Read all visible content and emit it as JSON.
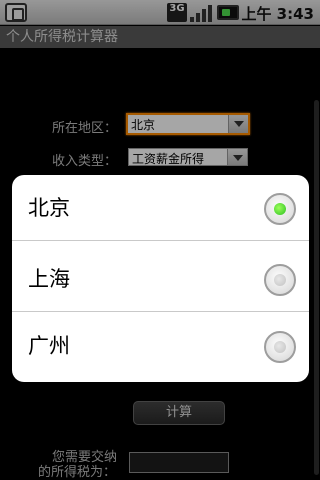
{
  "status_bar": {
    "network": "3G",
    "time": "上午 3:43"
  },
  "app": {
    "title": "个人所得税计算器"
  },
  "form": {
    "region_label": "所在地区：",
    "region_value": "北京",
    "income_label": "收入类型：",
    "income_value": "工资薪金所得",
    "calc_button": "计算",
    "result_label_line1": "您需要交纳",
    "result_label_line2": "的所得税为："
  },
  "dialog": {
    "options": [
      {
        "label": "北京",
        "checked": true
      },
      {
        "label": "上海",
        "checked": false
      },
      {
        "label": "广州",
        "checked": false
      }
    ],
    "accent_color": "#2bbf22"
  }
}
